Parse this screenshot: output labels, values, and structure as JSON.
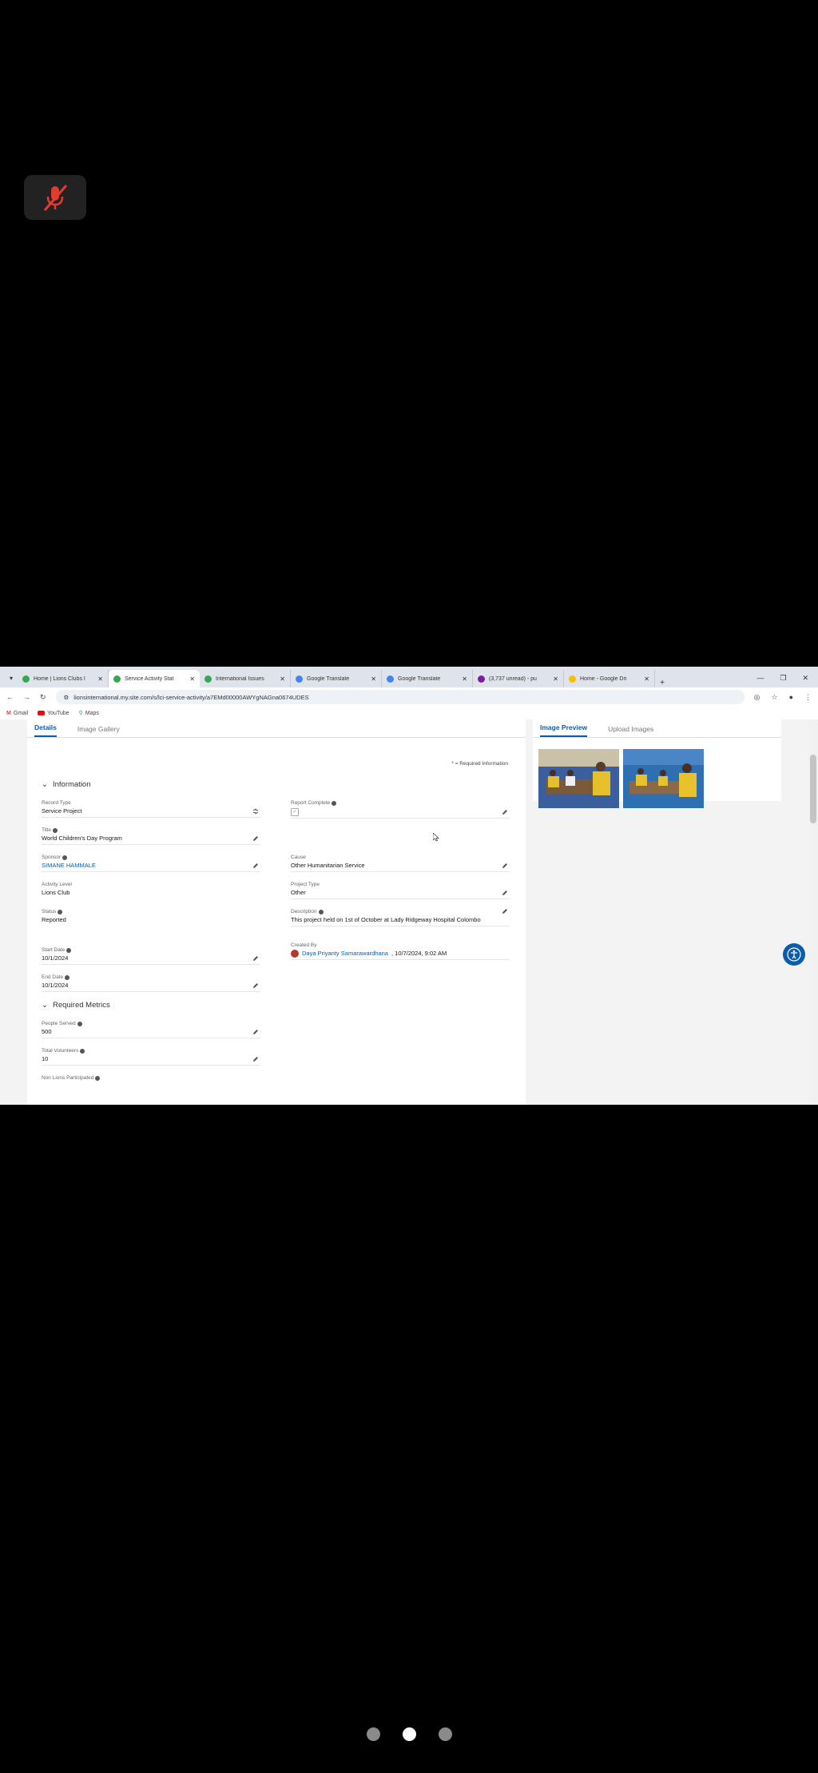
{
  "browser": {
    "tabs": [
      {
        "label": "Home | Lions Clubs I",
        "color": "#34a853",
        "active": false
      },
      {
        "label": "Service Activity Stat",
        "color": "#34a853",
        "active": true
      },
      {
        "label": "International Issues",
        "color": "#34a853",
        "active": false
      },
      {
        "label": "Google Translate",
        "color": "#4285f4",
        "active": false
      },
      {
        "label": "Google Translate",
        "color": "#4285f4",
        "active": false
      },
      {
        "label": "(3,737 unread) - pu",
        "color": "#7b1fa2",
        "active": false
      },
      {
        "label": "Home - Google Dri",
        "color": "#fbbc04",
        "active": false
      }
    ],
    "url": "lionsinternational.my.site.com/s/lci-service-activity/a7EMd00000AWYgNAGna0674UDES",
    "bookmarks": [
      {
        "label": "Gmail",
        "color": "#ea4335"
      },
      {
        "label": "YouTube",
        "color": "#ff0000"
      },
      {
        "label": "Maps",
        "color": "#34a853"
      }
    ]
  },
  "left_tabs": [
    "Details",
    "Image Gallery"
  ],
  "right_tabs": [
    "Image Preview",
    "Upload Images"
  ],
  "required_note": "* = Required Information",
  "sections": {
    "information": "Information",
    "required_metrics": "Required Metrics"
  },
  "fields": {
    "record_type": {
      "label": "Record Type",
      "value": "Service Project"
    },
    "report_complete": {
      "label": "Report Complete",
      "value": ""
    },
    "title": {
      "label": "Title",
      "value": "World Children's Day Program"
    },
    "sponsor": {
      "label": "Sponsor",
      "value": "SIMANE HAMMALE"
    },
    "cause": {
      "label": "Cause",
      "value": "Other Humanitarian Service"
    },
    "activity_level": {
      "label": "Activity Level",
      "value": "Lions Club"
    },
    "project_type": {
      "label": "Project Type",
      "value": "Other"
    },
    "status": {
      "label": "Status",
      "value": "Reported"
    },
    "description": {
      "label": "Description",
      "value": "This project held on 1st of October at Lady Ridgeway Hospital Colombo"
    },
    "created_by": {
      "label": "Created By",
      "value": "Daya Priyanty Samarawardhana",
      "date": ", 10/7/2024, 9:02 AM"
    },
    "start_date": {
      "label": "Start Date",
      "value": "10/1/2024"
    },
    "end_date": {
      "label": "End Date",
      "value": "10/1/2024"
    },
    "people_served": {
      "label": "People Served",
      "value": "500"
    },
    "total_volunteers": {
      "label": "Total Volunteers",
      "value": "10"
    },
    "non_lions_participated": {
      "label": "Non Lions Participated",
      "value": ""
    }
  },
  "pager": {
    "count": 3,
    "active": 1
  }
}
